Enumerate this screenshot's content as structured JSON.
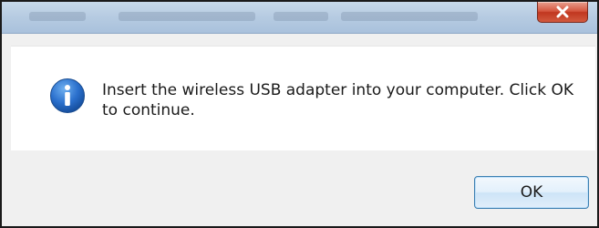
{
  "dialog": {
    "message": "Insert the wireless USB adapter into your computer. Click OK to continue.",
    "icon": "info-icon",
    "ok_label": "OK",
    "close_icon": "close-icon"
  },
  "colors": {
    "titlebar": "#b7cce2",
    "close_button": "#c8432b",
    "content_bg": "#ffffff",
    "footer_bg": "#f0f0f0",
    "info_icon": "#1f5fb8",
    "ok_border": "#3c7fb1"
  }
}
